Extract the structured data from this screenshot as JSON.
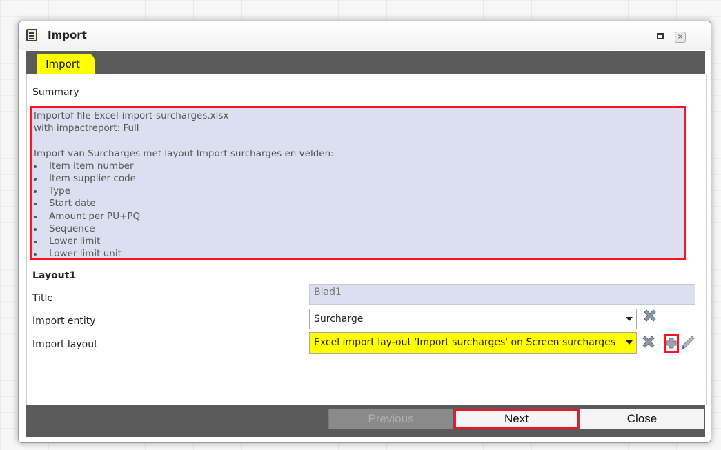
{
  "window": {
    "title": "Import",
    "app_icon": "table-icon",
    "maximize_icon": "maximize-icon",
    "close_icon": "close-icon"
  },
  "tabs": [
    {
      "label": "Import",
      "active": true,
      "color": "#ffff00"
    }
  ],
  "summary": {
    "label": "Summary",
    "lines": [
      "Importof file Excel-import-surcharges.xlsx",
      "with impactreport: Full",
      "",
      "Import van Surcharges met layout Import surcharges en velden:"
    ],
    "fields": [
      "Item item number",
      "Item supplier code",
      "Type",
      "Start date",
      "Amount per PU+PQ",
      "Sequence",
      "Lower limit",
      "Lower limit unit"
    ],
    "highlight_color": "#ff1020",
    "background": "#dcdff0"
  },
  "layout_section": {
    "heading": "Layout1",
    "title_label": "Title",
    "title_value": "Blad1",
    "entity_label": "Import entity",
    "entity_value": "Surcharge",
    "layout_label": "Import layout",
    "layout_value": "Excel import lay-out 'Import surcharges' on Screen surcharges",
    "layout_bg": "#ffff00",
    "icons": [
      "clear-icon",
      "clear-icon",
      "add-icon",
      "edit-icon"
    ]
  },
  "footer": {
    "previous_label": "Previous",
    "previous_enabled": false,
    "next_label": "Next",
    "close_label": "Close"
  },
  "colors": {
    "bar": "#5b5b5b",
    "accent": "#ffff00",
    "highlight": "#ff1020"
  }
}
